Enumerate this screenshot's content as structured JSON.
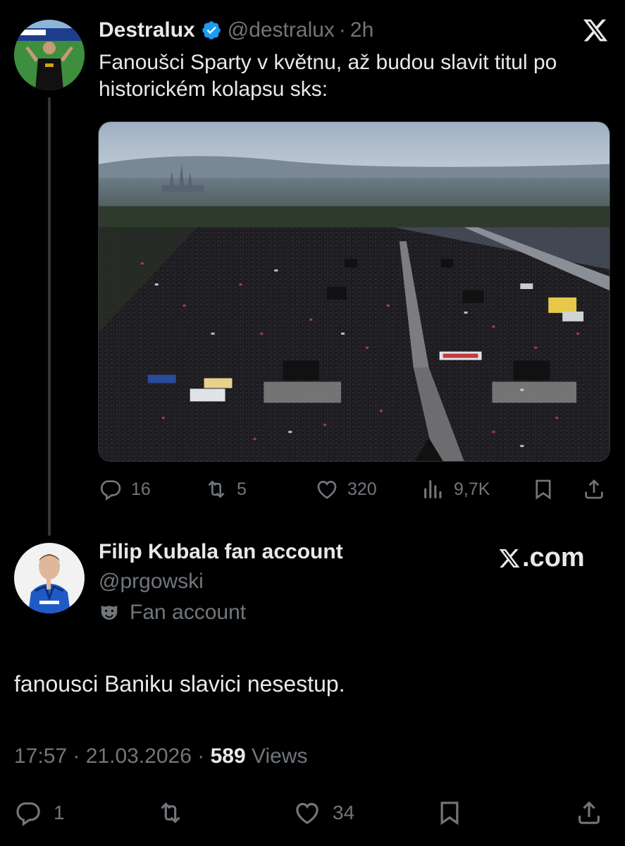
{
  "quoted_tweet": {
    "author_name": "Destralux",
    "handle": "@destralux",
    "separator": "·",
    "time": "2h",
    "text": "Fanoušci Sparty v květnu, až budou slavit titul po historickém kolapsu sks:",
    "stats": {
      "replies": "16",
      "reposts": "5",
      "likes": "320",
      "views": "9,7K"
    }
  },
  "reply_tweet": {
    "author_name": "Filip Kubala fan account",
    "handle": "@prgowski",
    "label": "Fan account",
    "text": "fanousci Baniku slavici nesestup.",
    "time": "17:57",
    "date": "21.03.2026",
    "views_count": "589",
    "views_label": "Views",
    "stats": {
      "replies": "1",
      "likes": "34"
    }
  },
  "watermark": ".com",
  "icons": [
    "verified-badge-icon",
    "x-logo-icon",
    "reply-icon",
    "repost-icon",
    "like-icon",
    "views-icon",
    "bookmark-icon",
    "share-icon",
    "theater-mask-icon"
  ],
  "colors": {
    "background": "#000000",
    "text_primary": "#e7e9ea",
    "text_secondary": "#71767b",
    "verified_blue": "#1d9bf0",
    "thread_line": "#333639"
  }
}
